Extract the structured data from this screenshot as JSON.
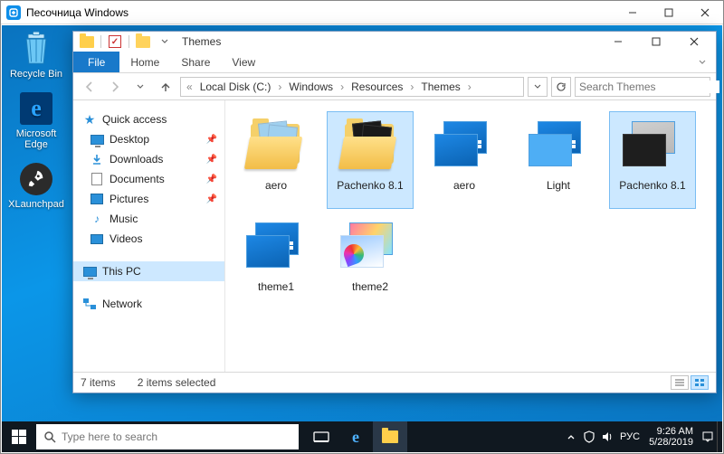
{
  "sandbox": {
    "title": "Песочница Windows"
  },
  "desktop": {
    "icons": [
      {
        "name": "recycle-bin",
        "label": "Recycle Bin"
      },
      {
        "name": "edge",
        "label": "Microsoft Edge"
      },
      {
        "name": "xlaunchpad",
        "label": "XLaunchpad"
      }
    ]
  },
  "explorer": {
    "qat_title": "Themes",
    "tabs": {
      "file": "File",
      "home": "Home",
      "share": "Share",
      "view": "View"
    },
    "breadcrumb": [
      "Local Disk (C:)",
      "Windows",
      "Resources",
      "Themes"
    ],
    "search_placeholder": "Search Themes",
    "nav": {
      "quick_access": "Quick access",
      "items": [
        {
          "label": "Desktop",
          "pinned": true
        },
        {
          "label": "Downloads",
          "pinned": true
        },
        {
          "label": "Documents",
          "pinned": true
        },
        {
          "label": "Pictures",
          "pinned": true
        },
        {
          "label": "Music",
          "pinned": false
        },
        {
          "label": "Videos",
          "pinned": false
        }
      ],
      "this_pc": "This PC",
      "network": "Network"
    },
    "files": [
      {
        "name": "aero",
        "kind": "folder-light",
        "selected": false
      },
      {
        "name": "Pachenko 8.1",
        "kind": "folder-dark",
        "selected": true
      },
      {
        "name": "aero",
        "kind": "theme",
        "selected": false
      },
      {
        "name": "Light",
        "kind": "theme-light",
        "selected": false
      },
      {
        "name": "Pachenko 8.1",
        "kind": "theme-dark",
        "selected": true
      },
      {
        "name": "theme1",
        "kind": "theme",
        "selected": false
      },
      {
        "name": "theme2",
        "kind": "theme-color",
        "selected": false
      }
    ],
    "status": {
      "count": "7 items",
      "selected": "2 items selected"
    }
  },
  "taskbar": {
    "search_placeholder": "Type here to search",
    "lang": "РУС",
    "time": "9:26 AM",
    "date": "5/28/2019"
  }
}
